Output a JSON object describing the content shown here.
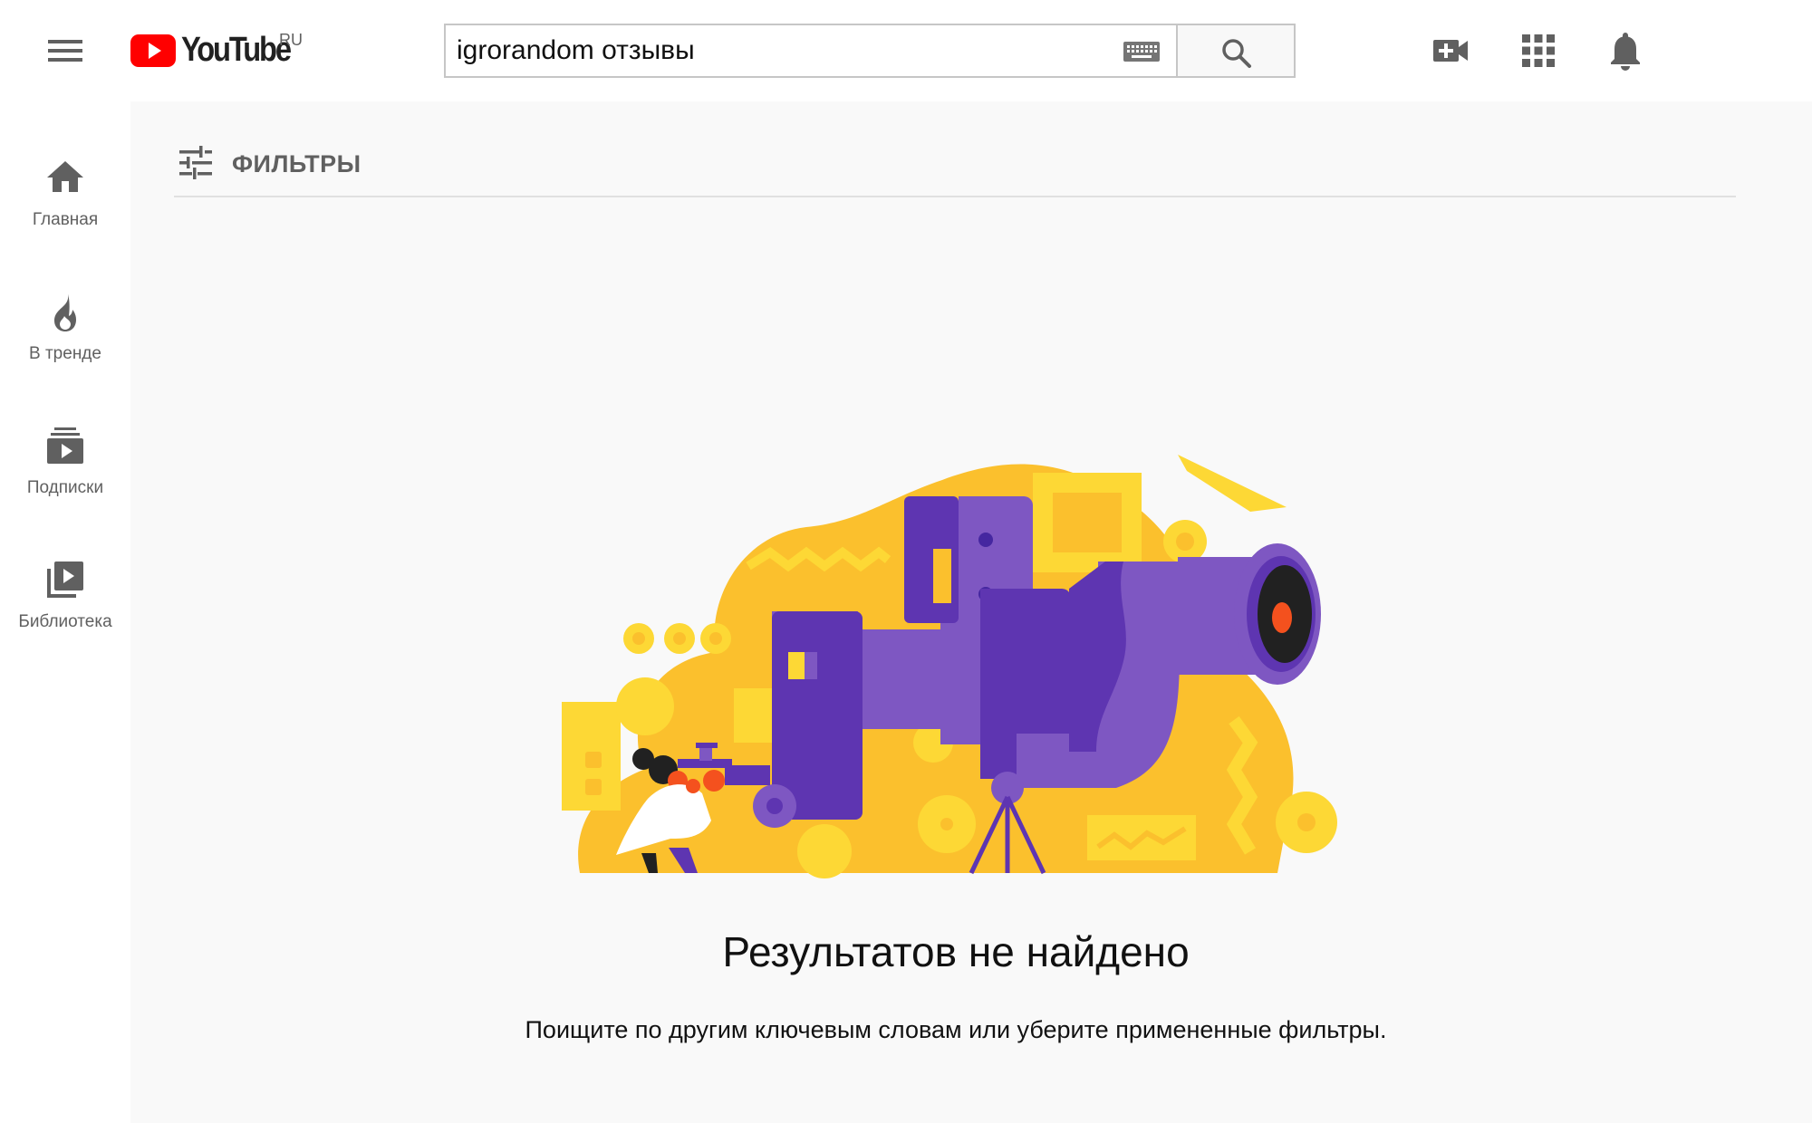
{
  "header": {
    "logo_text": "YouTube",
    "logo_country": "RU",
    "search_value": "igrorandom отзывы",
    "icons": [
      "menu-icon",
      "keyboard-icon",
      "search-icon",
      "create-video-icon",
      "apps-icon",
      "notifications-icon"
    ]
  },
  "sidebar": {
    "items": [
      {
        "label": "Главная",
        "icon": "home-icon"
      },
      {
        "label": "В тренде",
        "icon": "trending-icon"
      },
      {
        "label": "Подписки",
        "icon": "subscriptions-icon"
      },
      {
        "label": "Библиотека",
        "icon": "library-icon"
      }
    ]
  },
  "main": {
    "filters_label": "ФИЛЬТРЫ",
    "empty_title": "Результатов не найдено",
    "empty_subtitle": "Поищите по другим ключевым словам или уберите примененные фильтры."
  },
  "colors": {
    "brand_red": "#ff0000",
    "illustration_yellow": "#fbc02d",
    "illustration_purple": "#7e57c2",
    "illustration_dark_purple": "#5e35b1"
  }
}
